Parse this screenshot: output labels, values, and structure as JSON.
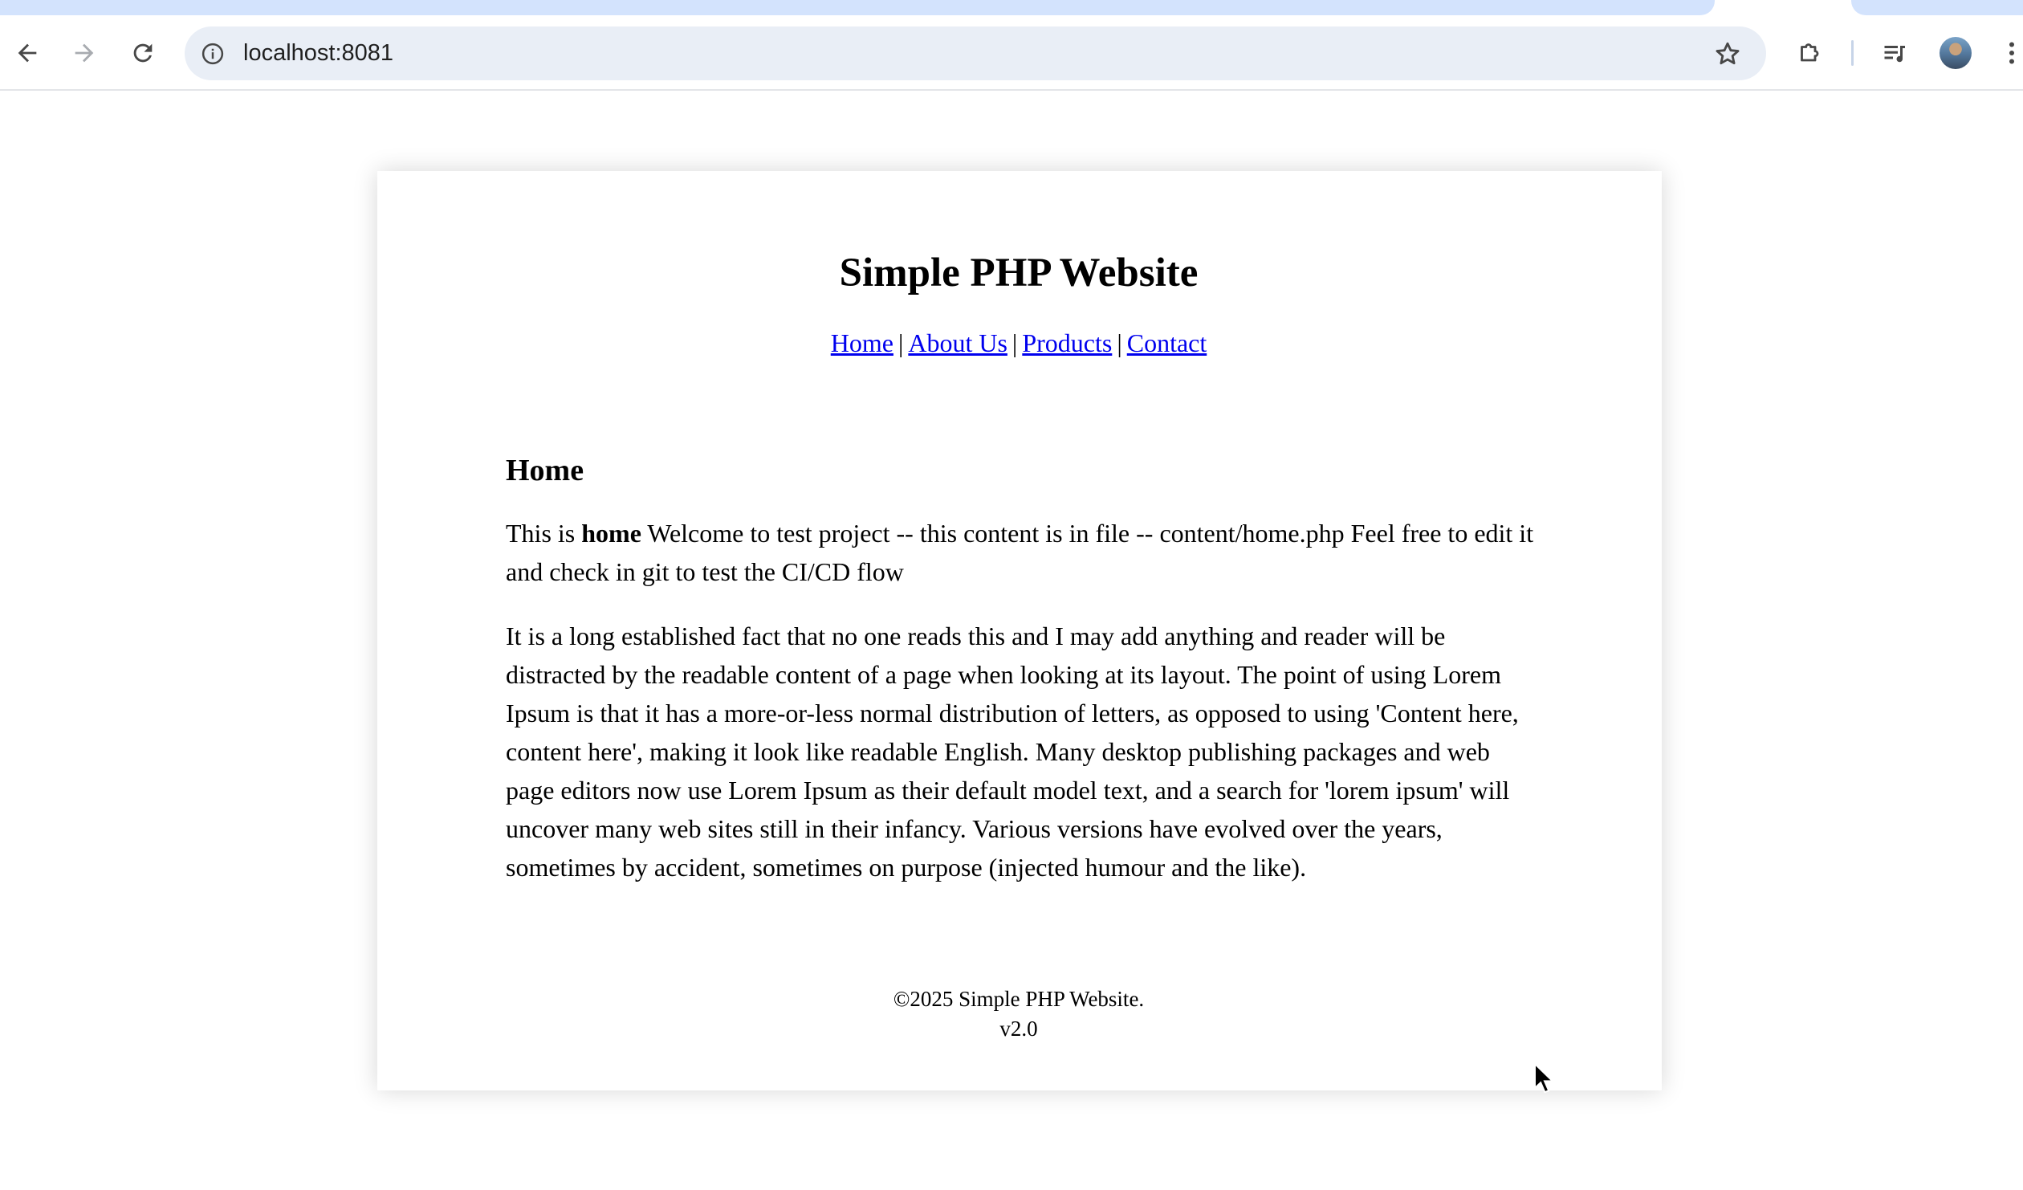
{
  "browser": {
    "url": "localhost:8081",
    "icons": {
      "back": "arrow-left-icon",
      "forward": "arrow-right-icon",
      "reload": "reload-icon",
      "site_info": "info-icon",
      "bookmark": "star-icon",
      "extensions": "puzzle-icon",
      "media": "media-control-icon",
      "profile": "avatar",
      "menu": "kebab-menu-icon"
    },
    "colors": {
      "tabstrip": "#d3e3fd",
      "omnibox": "#e9eef6"
    }
  },
  "site": {
    "title": "Simple PHP Website",
    "nav": [
      {
        "label": "Home"
      },
      {
        "label": "About Us"
      },
      {
        "label": "Products"
      },
      {
        "label": "Contact"
      }
    ],
    "nav_separator": "|",
    "link_color": "#0000ee"
  },
  "content": {
    "heading": "Home",
    "p1_prefix": "This is ",
    "p1_bold": "home",
    "p1_rest": " Welcome to test project -- this content is in file -- content/home.php Feel free to edit it and check in git to test the CI/CD flow",
    "p2": "It is a long established fact that no one reads this and I may add anything and reader will be distracted by the readable content of a page when looking at its layout. The point of using Lorem Ipsum is that it has a more-or-less normal distribution of letters, as opposed to using 'Content here, content here', making it look like readable English. Many desktop publishing packages and web page editors now use Lorem Ipsum as their default model text, and a search for 'lorem ipsum' will uncover many web sites still in their infancy. Various versions have evolved over the years, sometimes by accident, sometimes on purpose (injected humour and the like)."
  },
  "footer": {
    "copyright": "©2025 Simple PHP Website.",
    "version": "v2.0"
  }
}
